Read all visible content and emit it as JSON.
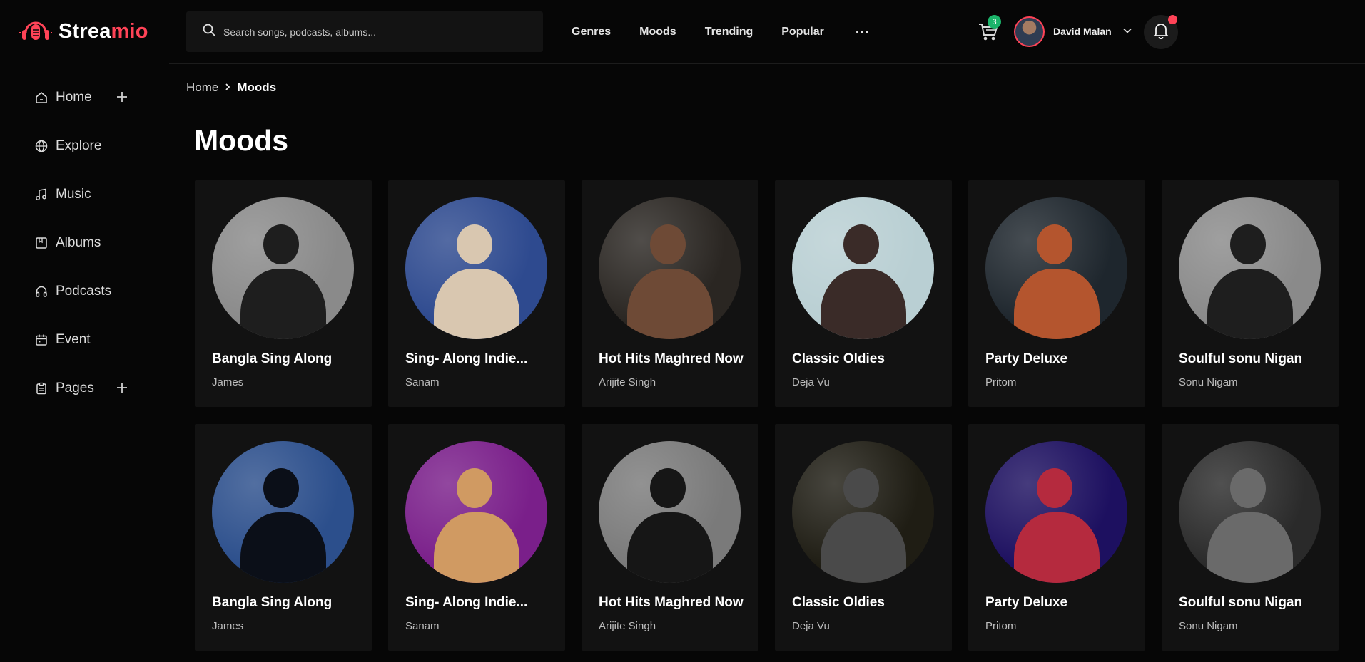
{
  "brand": {
    "name_part1": "Strea",
    "name_part2": "mio",
    "accent": "#ff4357"
  },
  "sidebar": {
    "items": [
      {
        "label": "Home",
        "icon": "home-icon",
        "has_plus": true
      },
      {
        "label": "Explore",
        "icon": "globe-icon",
        "has_plus": false
      },
      {
        "label": "Music",
        "icon": "music-note-icon",
        "has_plus": false
      },
      {
        "label": "Albums",
        "icon": "album-icon",
        "has_plus": false
      },
      {
        "label": "Podcasts",
        "icon": "headphones-icon",
        "has_plus": false
      },
      {
        "label": "Event",
        "icon": "calendar-icon",
        "has_plus": false
      },
      {
        "label": "Pages",
        "icon": "clipboard-icon",
        "has_plus": true
      }
    ]
  },
  "header": {
    "search_placeholder": "Search songs, podcasts, albums...",
    "nav": [
      "Genres",
      "Moods",
      "Trending",
      "Popular"
    ],
    "more": "···",
    "cart_count": "3",
    "user_name": "David Malan"
  },
  "breadcrumb": {
    "home": "Home",
    "current": "Moods"
  },
  "page_title": "Moods",
  "cards": [
    {
      "title": "Bangla Sing Along",
      "artist": "James",
      "bg": "#8a8a8a",
      "fig": "#1e1e1e"
    },
    {
      "title": "Sing- Along Indie...",
      "artist": "Sanam",
      "bg": "#2e4a8f",
      "fig": "#d9c7b0"
    },
    {
      "title": "Hot Hits Maghred Now",
      "artist": "Arijite Singh",
      "bg": "#2a2622",
      "fig": "#6e4a36"
    },
    {
      "title": "Classic Oldies",
      "artist": "Deja Vu",
      "bg": "#b9cfd3",
      "fig": "#3a2b28"
    },
    {
      "title": "Party Deluxe",
      "artist": "Pritom",
      "bg": "#1e262d",
      "fig": "#b4552e"
    },
    {
      "title": "Soulful sonu Nigan",
      "artist": "Sonu Nigam",
      "bg": "#8a8a8a",
      "fig": "#1e1e1e"
    },
    {
      "title": "Bangla Sing Along",
      "artist": "James",
      "bg": "#2c4f8c",
      "fig": "#0b0f18"
    },
    {
      "title": "Sing- Along Indie...",
      "artist": "Sanam",
      "bg": "#7a1f8a",
      "fig": "#d09a62"
    },
    {
      "title": "Hot Hits Maghred Now",
      "artist": "Arijite Singh",
      "bg": "#7a7a7a",
      "fig": "#161616"
    },
    {
      "title": "Classic Oldies",
      "artist": "Deja Vu",
      "bg": "#1f1d14",
      "fig": "#4a4a4a"
    },
    {
      "title": "Party Deluxe",
      "artist": "Pritom",
      "bg": "#1d1060",
      "fig": "#b52a3e"
    },
    {
      "title": "Soulful sonu Nigan",
      "artist": "Sonu Nigam",
      "bg": "#2a2a2a",
      "fig": "#6a6a6a"
    }
  ]
}
